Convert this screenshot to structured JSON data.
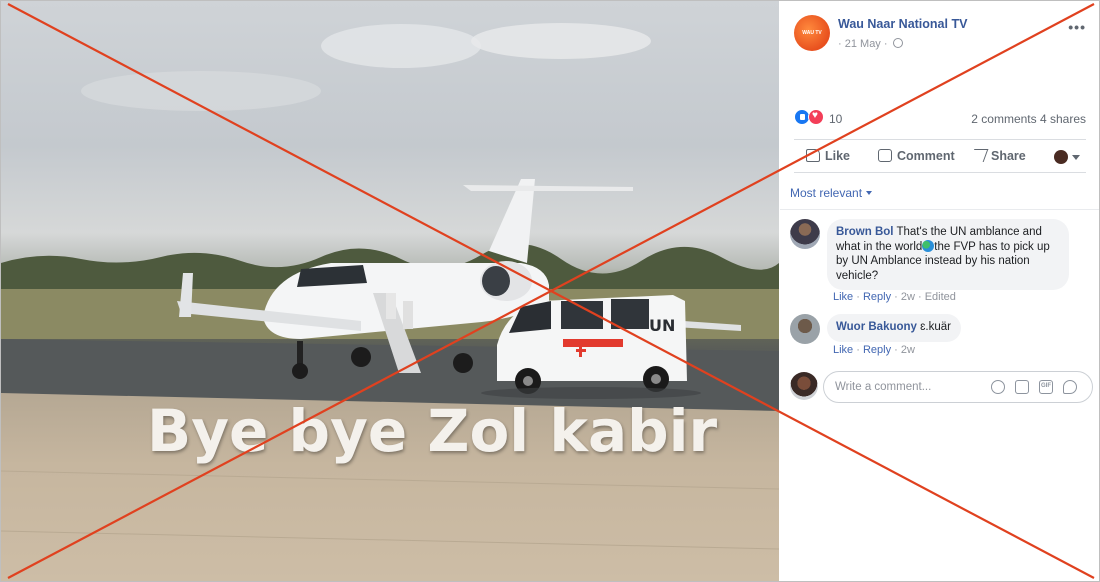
{
  "post": {
    "page_name": "Wau Naar National TV",
    "page_avatar_text": "WAU TV",
    "date": "21 May",
    "more_label": "•••"
  },
  "photo": {
    "caption": "Bye bye Zol kabir",
    "ambulance_text": "UN"
  },
  "reactions": {
    "count": "10",
    "comments_shares": "2 comments  4 shares"
  },
  "actions": {
    "like": "Like",
    "comment": "Comment",
    "share": "Share"
  },
  "sort_label": "Most relevant",
  "comments": [
    {
      "author": "Brown Bol",
      "text_before_icon": " That's the UN amblance and what in the world",
      "text_after_icon": "the FVP has to pick up by UN Amblance instead by his nation vehicle?",
      "like": "Like",
      "reply": "Reply",
      "age": "2w",
      "edited": "Edited"
    },
    {
      "author": "Wuor Bakuony",
      "text": " ɛ.kuär",
      "like": "Like",
      "reply": "Reply",
      "age": "2w"
    }
  ],
  "composer": {
    "placeholder": "Write a comment..."
  },
  "colors": {
    "link_blue": "#385898",
    "cross_red": "#e0411f"
  }
}
